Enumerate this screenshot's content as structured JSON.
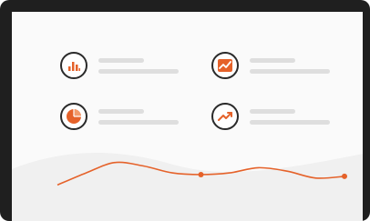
{
  "colors": {
    "accent": "#e5622a",
    "frame": "#1f1f1f",
    "screen": "#fafafa",
    "placeholder_line": "#dedede",
    "wave_fill": "#f0f0f0"
  },
  "widgets": [
    {
      "icon": "bar-chart-icon"
    },
    {
      "icon": "line-chart-icon"
    },
    {
      "icon": "pie-chart-icon"
    },
    {
      "icon": "trend-up-icon"
    }
  ],
  "chart_data": {
    "type": "line",
    "x": [
      0,
      1,
      2,
      3,
      4,
      5,
      6,
      7,
      8,
      9,
      10
    ],
    "series": [
      {
        "values": [
          0.2,
          0.55,
          0.85,
          0.75,
          0.55,
          0.5,
          0.55,
          0.7,
          0.6,
          0.4,
          0.45
        ]
      }
    ],
    "markers": [
      5,
      10
    ],
    "grid": false
  }
}
